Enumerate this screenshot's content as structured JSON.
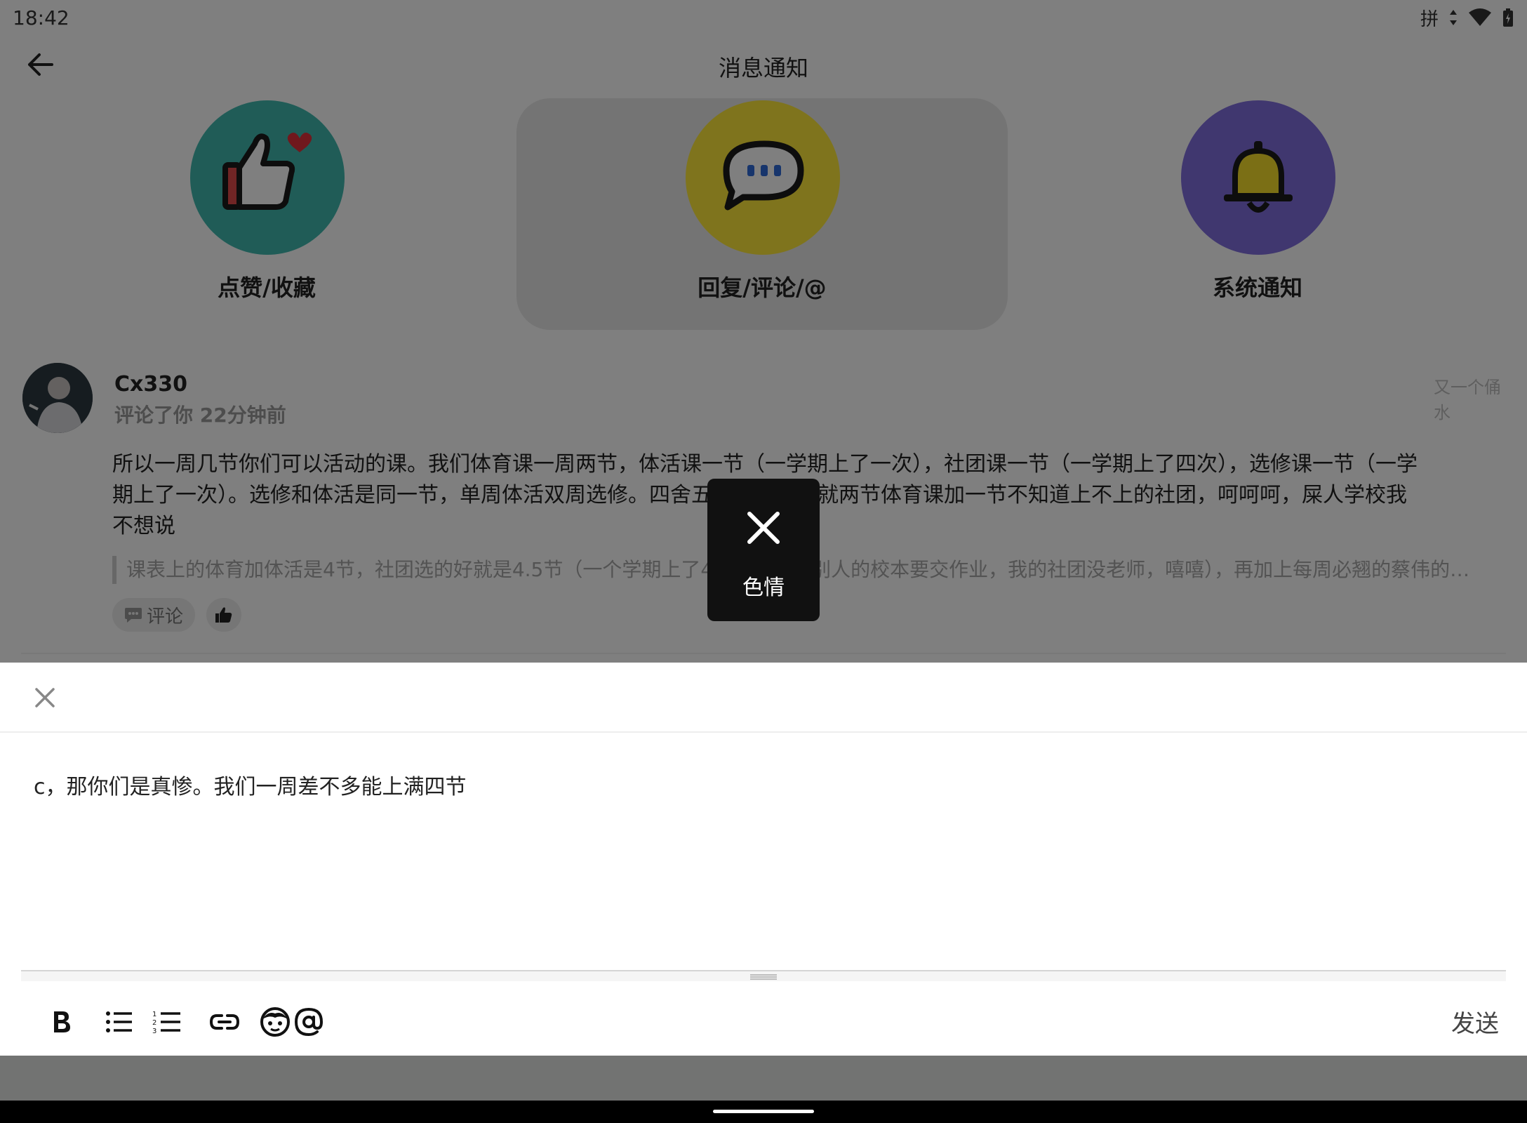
{
  "status_bar": {
    "time": "18:42",
    "ime_label": "拼"
  },
  "header": {
    "title": "消息通知"
  },
  "categories": [
    {
      "label": "点赞/收藏",
      "color": "#40b8ae"
    },
    {
      "label": "回复/评论/@",
      "color": "#ffe93b"
    },
    {
      "label": "系统通知",
      "color": "#806ede"
    }
  ],
  "notification": {
    "username": "Cx330",
    "action": "评论了你 22分钟前",
    "source_title": "又一个俑水",
    "comment": "所以一周几节你们可以活动的课。我们体育课一周两节，体活课一节（一学期上了一次），社团课一节（一学期上了四次），选修课一节（一学期上了一次）。选修和体活是同一节，单周体活双周选修。四舍五入我们一周就两节体育课加一节不知道上不上的社团，呵呵呵，屎人学校我不想说",
    "quote": "课表上的体育加体活是4节，社团选的好就是4.5节（一个学期上了4节社团），（别人的校本要交作业，我的社团没老师，嘻嘻），再加上每周必翘的蔡伟的…",
    "comment_button": "评论"
  },
  "toast": {
    "text": "色情"
  },
  "composer": {
    "text": "c，那你们是真惨。我们一周差不多能上满四节",
    "send_label": "发送"
  }
}
